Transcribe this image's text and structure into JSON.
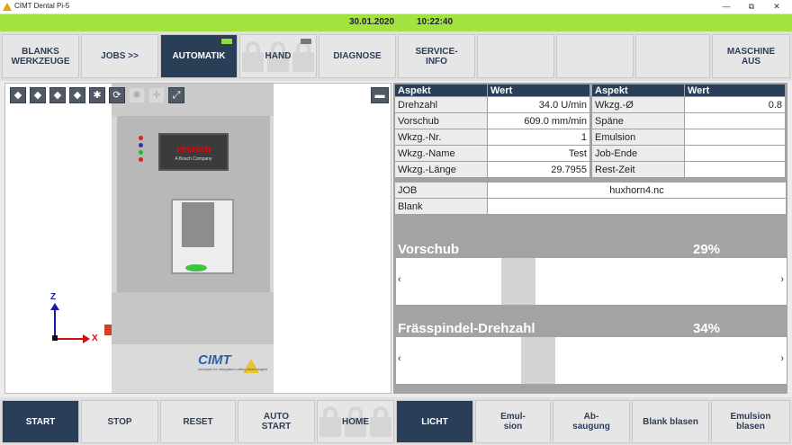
{
  "window": {
    "title": "CIMT Dental Pi-5",
    "min": "—",
    "restore": "⧉",
    "close": "✕"
  },
  "status": {
    "date": "30.01.2020",
    "time": "10:22:40",
    "color": "#a2e340"
  },
  "top_buttons": [
    {
      "label": "BLANKS\nWERKZEUGE"
    },
    {
      "label": "JOBS >>"
    },
    {
      "label": "AUTOMATIK",
      "active": true
    },
    {
      "label": "HAND",
      "locked": true
    },
    {
      "label": "DIAGNOSE"
    },
    {
      "label": "SERVICE-\nINFO"
    },
    {
      "label": ""
    },
    {
      "label": ""
    },
    {
      "label": ""
    },
    {
      "label": "MASCHINE\nAUS"
    }
  ],
  "viewport": {
    "tools": [
      "iso-view-icon",
      "front-view-icon",
      "side-view-icon",
      "top-view-icon",
      "fit-view-icon",
      "rotate-icon",
      "zoom-icon",
      "pan-icon",
      "fullscreen-icon"
    ],
    "machine": {
      "brand": "rexroth",
      "brand_sub": "A Bosch Company",
      "logo": "CIMT",
      "claim": "concepts for integrated cutting technologies"
    },
    "axes": {
      "z": "Z",
      "x": "X"
    }
  },
  "table_left": {
    "headers": [
      "Aspekt",
      "Wert"
    ],
    "rows": [
      [
        "Drehzahl",
        "34.0 U/min"
      ],
      [
        "Vorschub",
        "609.0 mm/min"
      ],
      [
        "Wkzg.-Nr.",
        "1"
      ],
      [
        "Wkzg.-Name",
        "Test"
      ],
      [
        "Wkzg.-Länge",
        "29.7955"
      ]
    ]
  },
  "table_right": {
    "headers": [
      "Aspekt",
      "Wert"
    ],
    "rows": [
      [
        "Wkzg.-Ø",
        "0.8"
      ],
      [
        "Späne",
        ""
      ],
      [
        "Emulsion",
        ""
      ],
      [
        "Job-Ende",
        ""
      ],
      [
        "Rest-Zeit",
        ""
      ]
    ]
  },
  "job": {
    "label": "JOB",
    "value": "huxhorn4.nc"
  },
  "blank": {
    "label": "Blank",
    "value": ""
  },
  "slider_feed": {
    "label": "Vorschub",
    "percent": "29%",
    "value": 0.29,
    "left": "‹",
    "right": "›"
  },
  "slider_spindle": {
    "label": "Frässpindel-Drehzahl",
    "percent": "34%",
    "value": 0.34,
    "left": "‹",
    "right": "›"
  },
  "bottom_buttons": [
    {
      "label": "START",
      "active": true
    },
    {
      "label": "STOP"
    },
    {
      "label": "RESET"
    },
    {
      "label": "AUTO\nSTART"
    },
    {
      "label": "HOME",
      "locked": true
    },
    {
      "label": "LICHT",
      "active": true
    },
    {
      "label": "Emul-\nsion"
    },
    {
      "label": "Ab-\nsaugung"
    },
    {
      "label": "Blank blasen"
    },
    {
      "label": "Emulsion\nblasen"
    }
  ]
}
